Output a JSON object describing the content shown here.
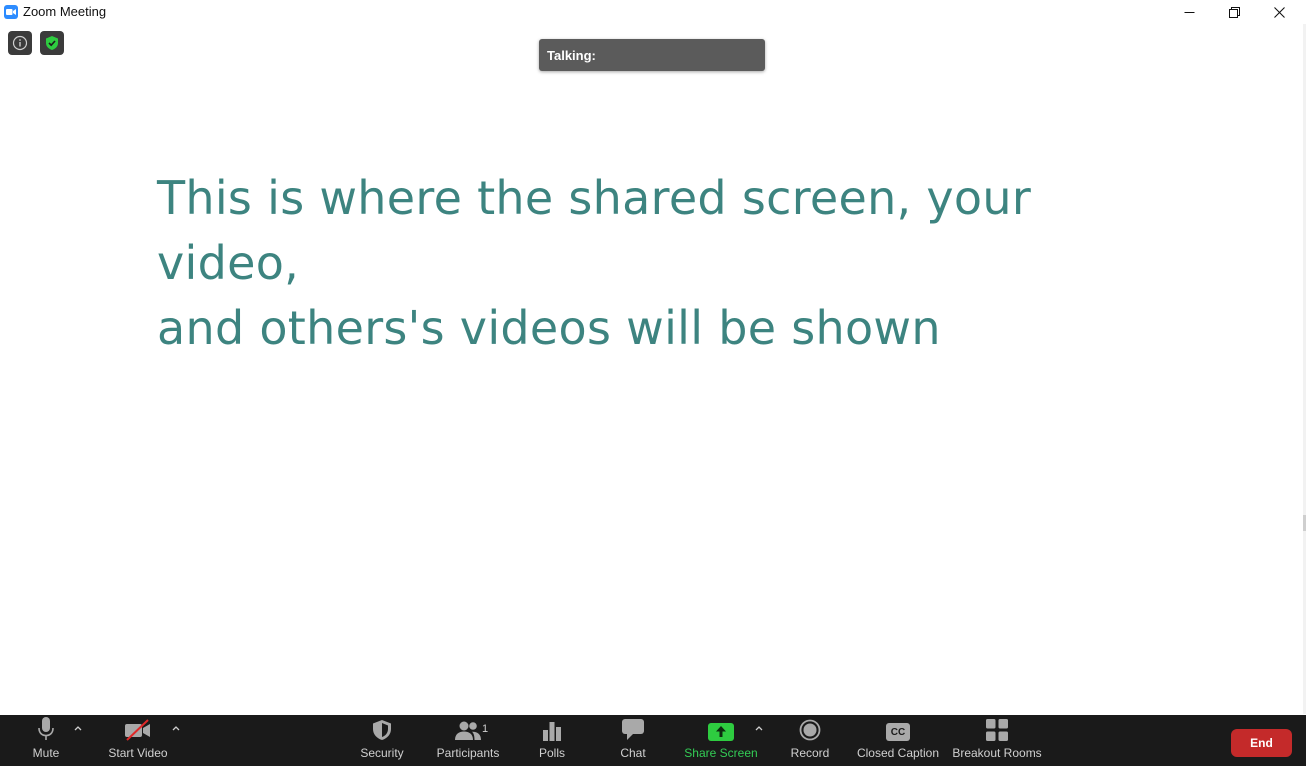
{
  "window": {
    "title": "Zoom Meeting"
  },
  "talking": {
    "label": "Talking:"
  },
  "main": {
    "line1": "This is where the shared screen, your video,",
    "line2": "and others's videos will be shown"
  },
  "toolbar": {
    "mute_label": "Mute",
    "video_label": "Start Video",
    "security_label": "Security",
    "participants_label": "Participants",
    "participants_count": "1",
    "polls_label": "Polls",
    "chat_label": "Chat",
    "share_label": "Share Screen",
    "record_label": "Record",
    "cc_label": "Closed Caption",
    "cc_icon_text": "CC",
    "breakout_label": "Breakout Rooms",
    "end_label": "End"
  },
  "colors": {
    "accent_text": "#3d8480",
    "toolbar_bg": "#1a1a1a",
    "share_green": "#33cc55",
    "end_red": "#c42a2a",
    "zoom_blue": "#2d8cff",
    "shield_green": "#2ecc40"
  },
  "icons": {
    "app": "zoom-camera-icon",
    "info": "info-icon",
    "security_badge": "shield-check-icon",
    "mute": "microphone-icon",
    "video": "video-off-icon",
    "security": "shield-icon",
    "participants": "people-icon",
    "polls": "bar-chart-icon",
    "chat": "chat-bubble-icon",
    "share": "share-arrow-icon",
    "record": "record-icon",
    "cc": "cc-icon",
    "breakout": "grid-icon"
  }
}
